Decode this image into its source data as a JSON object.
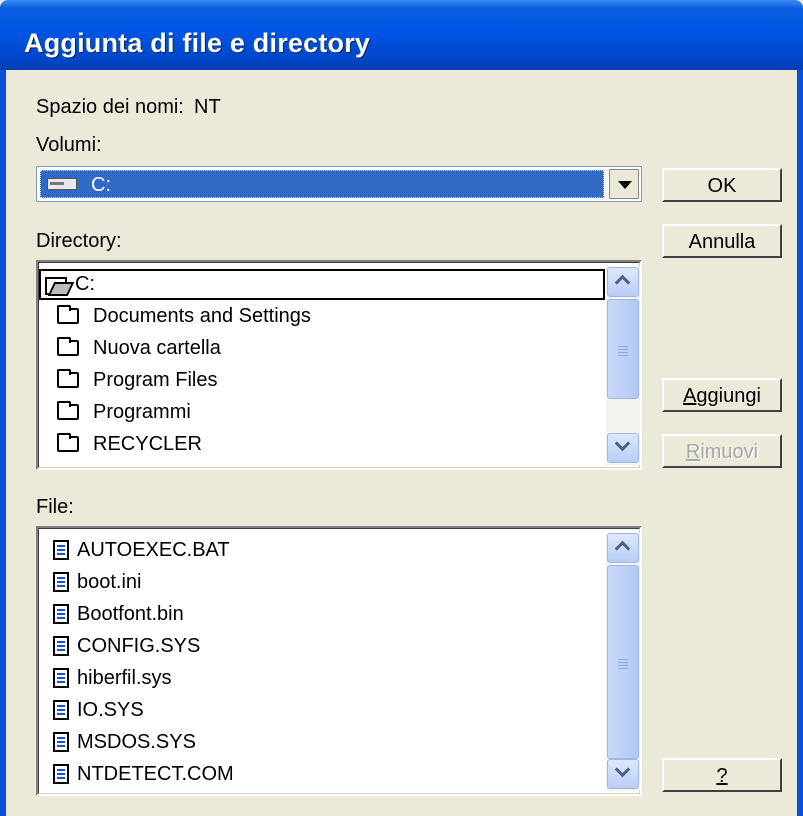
{
  "window": {
    "title": "Aggiunta di file e directory"
  },
  "namespace": {
    "label": "Spazio dei nomi:",
    "value": "NT"
  },
  "volumes": {
    "label": "Volumi:",
    "selected": "C:",
    "icon": "drive-icon"
  },
  "directory": {
    "label": "Directory:",
    "items": [
      {
        "label": "C:",
        "icon": "open-folder-icon"
      },
      {
        "label": "Documents and Settings",
        "icon": "folder-icon"
      },
      {
        "label": "Nuova cartella",
        "icon": "folder-icon"
      },
      {
        "label": "Program Files",
        "icon": "folder-icon"
      },
      {
        "label": "Programmi",
        "icon": "folder-icon"
      },
      {
        "label": "RECYCLER",
        "icon": "folder-icon"
      }
    ]
  },
  "files": {
    "label": "File:",
    "items": [
      {
        "label": "AUTOEXEC.BAT",
        "icon": "file-icon"
      },
      {
        "label": "boot.ini",
        "icon": "file-icon"
      },
      {
        "label": "Bootfont.bin",
        "icon": "file-icon"
      },
      {
        "label": "CONFIG.SYS",
        "icon": "file-icon"
      },
      {
        "label": "hiberfil.sys",
        "icon": "file-icon"
      },
      {
        "label": "IO.SYS",
        "icon": "file-icon"
      },
      {
        "label": "MSDOS.SYS",
        "icon": "file-icon"
      },
      {
        "label": "NTDETECT.COM",
        "icon": "file-icon"
      }
    ]
  },
  "buttons": {
    "ok": "OK",
    "cancel": "Annulla",
    "add_accel": "A",
    "add_rest": "ggiungi",
    "remove_accel": "R",
    "remove_rest": "imuovi",
    "help": "?"
  },
  "colors": {
    "title_bar": "#0055e5",
    "selection": "#316ac5",
    "dialog_bg": "#ece9d8"
  }
}
